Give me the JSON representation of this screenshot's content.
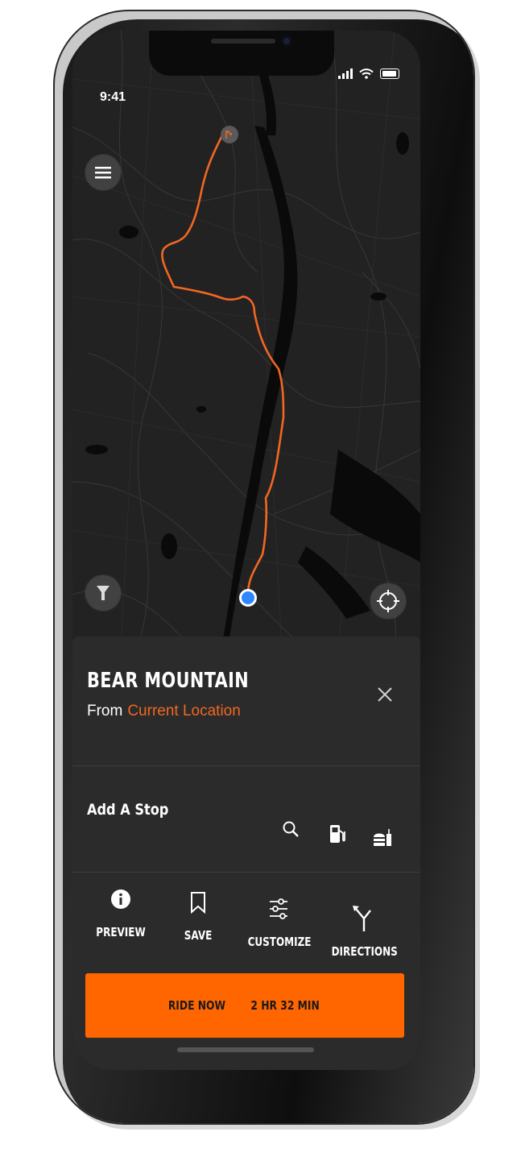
{
  "status_bar": {
    "time": "9:41"
  },
  "map": {
    "route_color": "#f26722",
    "current_location_color": "#2f87ff",
    "icons": {
      "menu": "hamburger-menu-icon",
      "filter": "funnel-filter-icon",
      "locate": "crosshair-locate-icon",
      "finish": "checkered-flag-icon"
    }
  },
  "destination": {
    "title": "BEAR MOUNTAIN",
    "from_label": "From",
    "from_location": "Current Location"
  },
  "add_stop": {
    "label": "Add A Stop",
    "icons": [
      "search-icon",
      "fuel-pump-icon",
      "food-burger-icon"
    ]
  },
  "actions": [
    {
      "label": "PREVIEW",
      "icon": "info-icon"
    },
    {
      "label": "SAVE",
      "icon": "bookmark-icon"
    },
    {
      "label": "CUSTOMIZE",
      "icon": "sliders-icon"
    },
    {
      "label": "DIRECTIONS",
      "icon": "turn-directions-icon"
    }
  ],
  "ride_button": {
    "label": "RIDE NOW",
    "duration": "2 HR 32 MIN",
    "color": "#ff6600"
  }
}
